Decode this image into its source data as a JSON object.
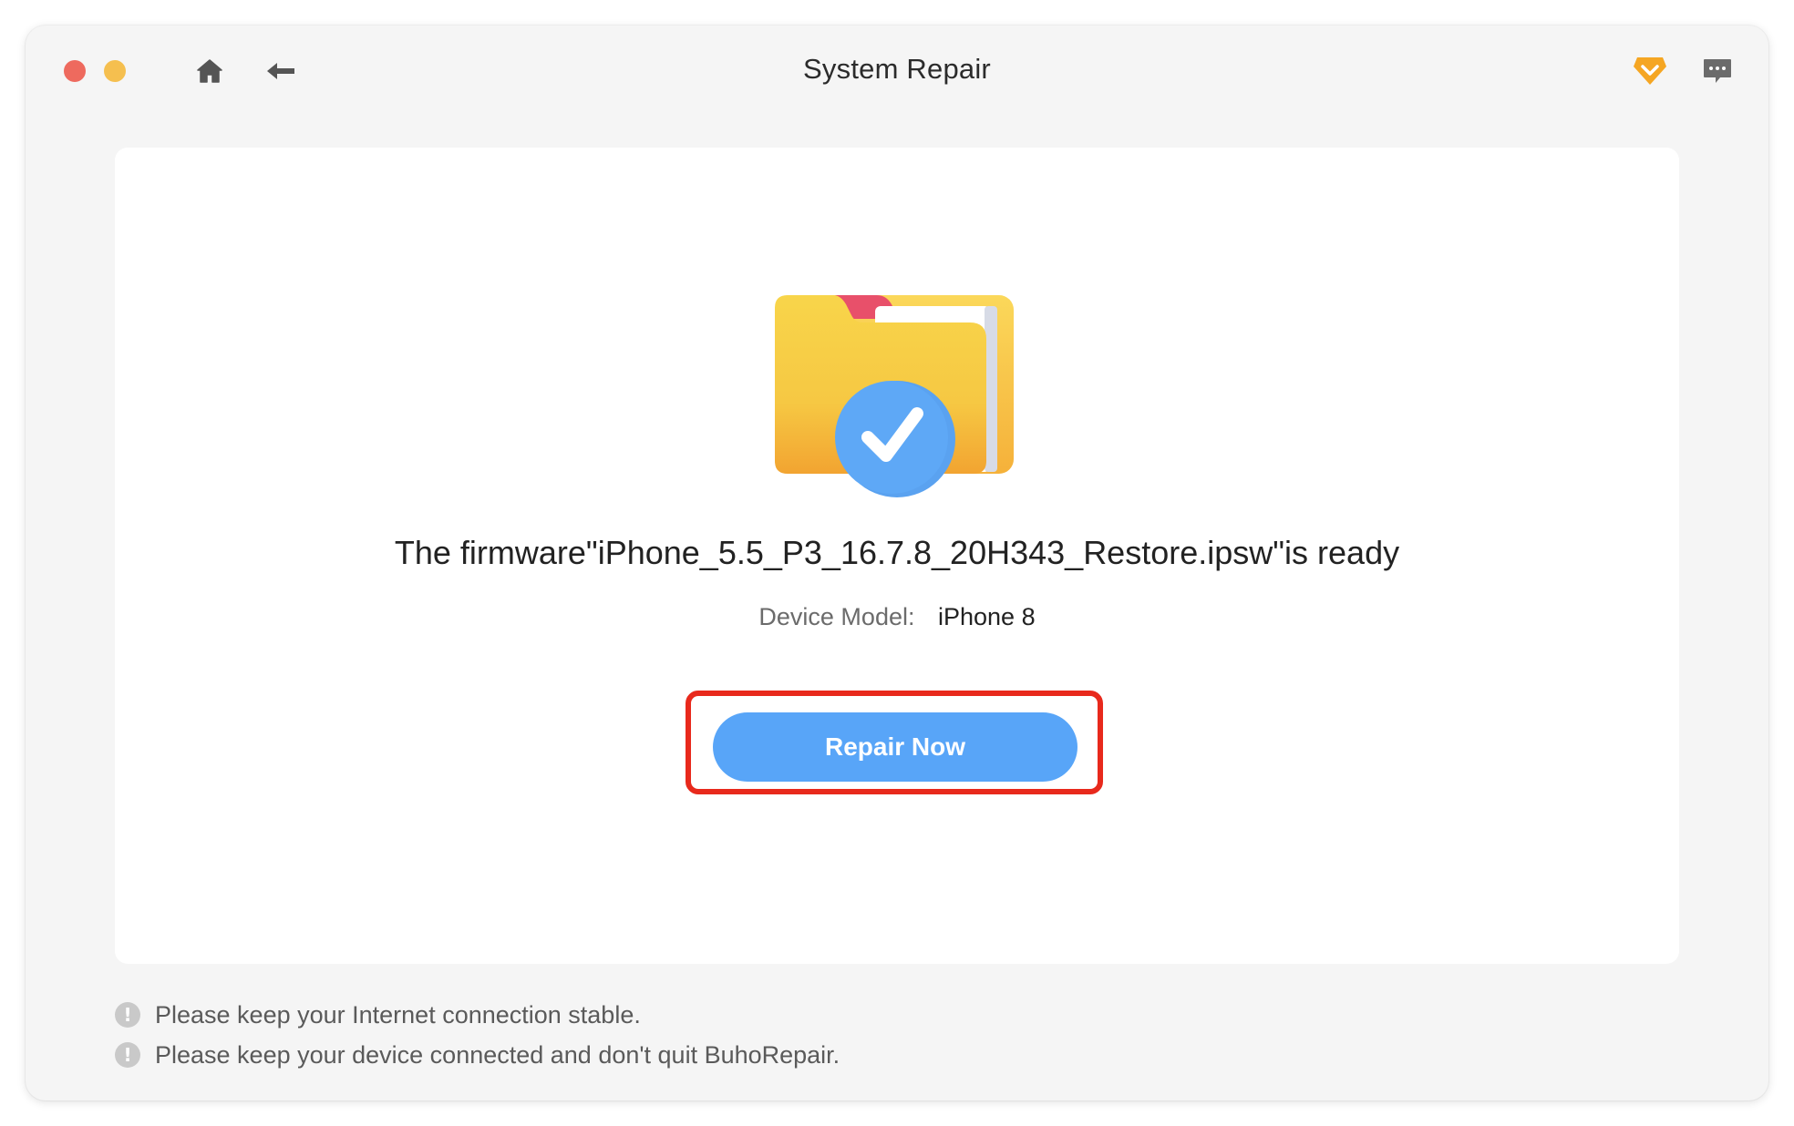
{
  "window": {
    "title": "System Repair"
  },
  "toolbar": {
    "home_icon": "home-icon",
    "back_icon": "back-arrow-icon",
    "premium_icon": "diamond-icon",
    "feedback_icon": "chat-bubble-icon"
  },
  "main": {
    "illustration": "folder-check-icon",
    "headline": "The firmware\"iPhone_5.5_P3_16.7.8_20H343_Restore.ipsw\"is ready",
    "device_model_label": "Device Model:",
    "device_model_value": "iPhone 8",
    "repair_button_label": "Repair Now"
  },
  "notes": [
    {
      "icon": "exclamation-icon",
      "text": "Please keep your Internet connection stable."
    },
    {
      "icon": "exclamation-icon",
      "text": "Please keep your device connected and don't quit BuhoRepair."
    }
  ],
  "colors": {
    "accent": "#58a5f8",
    "highlight": "#e8291c",
    "close": "#ee6a5e",
    "minimize": "#f5bf4f",
    "premium": "#f5a623"
  }
}
